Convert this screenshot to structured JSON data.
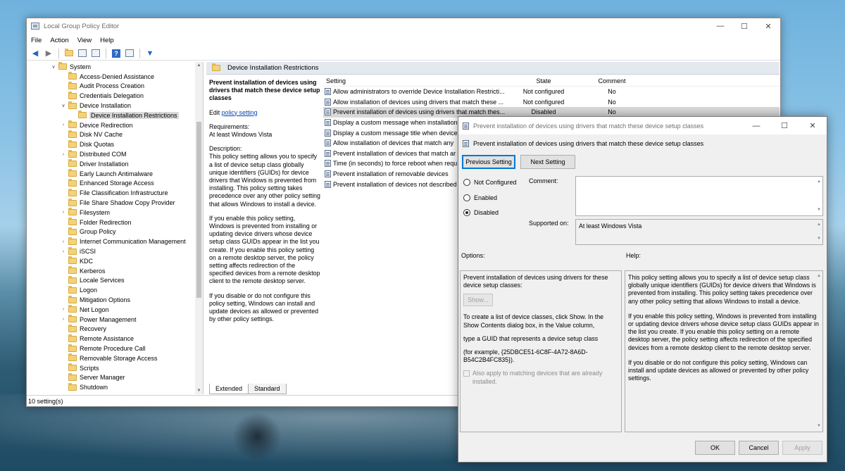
{
  "main_window": {
    "title": "Local Group Policy Editor",
    "controls": {
      "minimize": "—",
      "maximize": "☐",
      "close": "✕"
    },
    "menu": [
      "File",
      "Action",
      "View",
      "Help"
    ],
    "status": "10 setting(s)"
  },
  "tree": {
    "items": [
      {
        "label": "System",
        "depth": 0,
        "expander": "open"
      },
      {
        "label": "Access-Denied Assistance",
        "depth": 1,
        "expander": "none"
      },
      {
        "label": "Audit Process Creation",
        "depth": 1,
        "expander": "none"
      },
      {
        "label": "Credentials Delegation",
        "depth": 1,
        "expander": "none"
      },
      {
        "label": "Device Installation",
        "depth": 1,
        "expander": "open"
      },
      {
        "label": "Device Installation Restrictions",
        "depth": 2,
        "expander": "none",
        "selected": true
      },
      {
        "label": "Device Redirection",
        "depth": 1,
        "expander": "closed"
      },
      {
        "label": "Disk NV Cache",
        "depth": 1,
        "expander": "none"
      },
      {
        "label": "Disk Quotas",
        "depth": 1,
        "expander": "none"
      },
      {
        "label": "Distributed COM",
        "depth": 1,
        "expander": "closed"
      },
      {
        "label": "Driver Installation",
        "depth": 1,
        "expander": "none"
      },
      {
        "label": "Early Launch Antimalware",
        "depth": 1,
        "expander": "none"
      },
      {
        "label": "Enhanced Storage Access",
        "depth": 1,
        "expander": "none"
      },
      {
        "label": "File Classification Infrastructure",
        "depth": 1,
        "expander": "none"
      },
      {
        "label": "File Share Shadow Copy Provider",
        "depth": 1,
        "expander": "none"
      },
      {
        "label": "Filesystem",
        "depth": 1,
        "expander": "closed"
      },
      {
        "label": "Folder Redirection",
        "depth": 1,
        "expander": "none"
      },
      {
        "label": "Group Policy",
        "depth": 1,
        "expander": "none"
      },
      {
        "label": "Internet Communication Management",
        "depth": 1,
        "expander": "closed"
      },
      {
        "label": "iSCSI",
        "depth": 1,
        "expander": "closed"
      },
      {
        "label": "KDC",
        "depth": 1,
        "expander": "none"
      },
      {
        "label": "Kerberos",
        "depth": 1,
        "expander": "none"
      },
      {
        "label": "Locale Services",
        "depth": 1,
        "expander": "none"
      },
      {
        "label": "Logon",
        "depth": 1,
        "expander": "none"
      },
      {
        "label": "Mitigation Options",
        "depth": 1,
        "expander": "none"
      },
      {
        "label": "Net Logon",
        "depth": 1,
        "expander": "closed"
      },
      {
        "label": "Power Management",
        "depth": 1,
        "expander": "closed"
      },
      {
        "label": "Recovery",
        "depth": 1,
        "expander": "none"
      },
      {
        "label": "Remote Assistance",
        "depth": 1,
        "expander": "none"
      },
      {
        "label": "Remote Procedure Call",
        "depth": 1,
        "expander": "none"
      },
      {
        "label": "Removable Storage Access",
        "depth": 1,
        "expander": "none"
      },
      {
        "label": "Scripts",
        "depth": 1,
        "expander": "none"
      },
      {
        "label": "Server Manager",
        "depth": 1,
        "expander": "none"
      },
      {
        "label": "Shutdown",
        "depth": 1,
        "expander": "none"
      }
    ]
  },
  "pane": {
    "header": "Device Installation Restrictions",
    "desc": {
      "title": "Prevent installation of devices using drivers that match these device setup classes",
      "edit_prefix": "Edit ",
      "edit_link": "policy setting",
      "requirements_label": "Requirements:",
      "requirements_value": "At least Windows Vista",
      "description_label": "Description:",
      "p1": "This policy setting allows you to specify a list of device setup class globally unique identifiers (GUIDs) for device drivers that Windows is prevented from installing. This policy setting takes precedence over any other policy setting that allows Windows to install a device.",
      "p2": "If you enable this policy setting, Windows is prevented from installing or updating device drivers whose device setup class GUIDs appear in the list you create. If you enable this policy setting on a remote desktop server, the policy setting affects redirection of the specified devices from a remote desktop client to the remote desktop server.",
      "p3": "If you disable or do not configure this policy setting, Windows can install and update devices as allowed or prevented by other policy settings."
    },
    "columns": {
      "setting": "Setting",
      "state": "State",
      "comment": "Comment"
    },
    "rows": [
      {
        "setting": "Allow administrators to override Device Installation Restricti...",
        "state": "Not configured",
        "comment": "No"
      },
      {
        "setting": "Allow installation of devices using drivers that match these ...",
        "state": "Not configured",
        "comment": "No"
      },
      {
        "setting": "Prevent installation of devices using drivers that match thes...",
        "state": "Disabled",
        "comment": "No",
        "selected": true
      },
      {
        "setting": "Display a custom message when installation",
        "state": "",
        "comment": ""
      },
      {
        "setting": "Display a custom message title when device",
        "state": "",
        "comment": ""
      },
      {
        "setting": "Allow installation of devices that match any",
        "state": "",
        "comment": ""
      },
      {
        "setting": "Prevent installation of devices that match ar",
        "state": "",
        "comment": ""
      },
      {
        "setting": "Time (in seconds) to force reboot when requ",
        "state": "",
        "comment": ""
      },
      {
        "setting": "Prevent installation of removable devices",
        "state": "",
        "comment": ""
      },
      {
        "setting": "Prevent installation of devices not described",
        "state": "",
        "comment": ""
      }
    ],
    "tabs": [
      "Extended",
      "Standard"
    ]
  },
  "dialog": {
    "title": "Prevent installation of devices using drivers that match these device setup classes",
    "subtitle": "Prevent installation of devices using drivers that match these device setup classes",
    "controls": {
      "minimize": "—",
      "maximize": "☐",
      "close": "✕"
    },
    "prev_button": "Previous Setting",
    "next_button": "Next Setting",
    "radio": {
      "not_configured": "Not Configured",
      "enabled": "Enabled",
      "disabled": "Disabled",
      "selected": "disabled"
    },
    "comment_label": "Comment:",
    "comment_value": "",
    "supported_label": "Supported on:",
    "supported_value": "At least Windows Vista",
    "options_label": "Options:",
    "help_label": "Help:",
    "options": {
      "line1": "Prevent installation of devices using drivers for these device setup classes:",
      "show_button": "Show...",
      "line2": "To create a list of device classes, click Show. In the Show Contents dialog box, in the Value column,",
      "line3": "type a GUID that represents a device setup class",
      "line4": "(for example, {25DBCE51-6C8F-4A72-8A6D-B54C2B4FC835}).",
      "checkbox": "Also apply to matching devices that are already installed."
    },
    "help": {
      "p1": "This policy setting allows you to specify a list of device setup class globally unique identifiers (GUIDs) for device drivers that Windows is prevented from installing. This policy setting takes precedence over any other policy setting that allows Windows to install a device.",
      "p2": "If you enable this policy setting, Windows is prevented from installing or updating device drivers whose device setup class GUIDs appear in the list you create. If you enable this policy setting on a remote desktop server, the policy setting affects redirection of the specified devices from a remote desktop client to the remote desktop server.",
      "p3": "If you disable or do not configure this policy setting, Windows can install and update devices as allowed or prevented by other policy settings."
    },
    "ok": "OK",
    "cancel": "Cancel",
    "apply": "Apply"
  }
}
